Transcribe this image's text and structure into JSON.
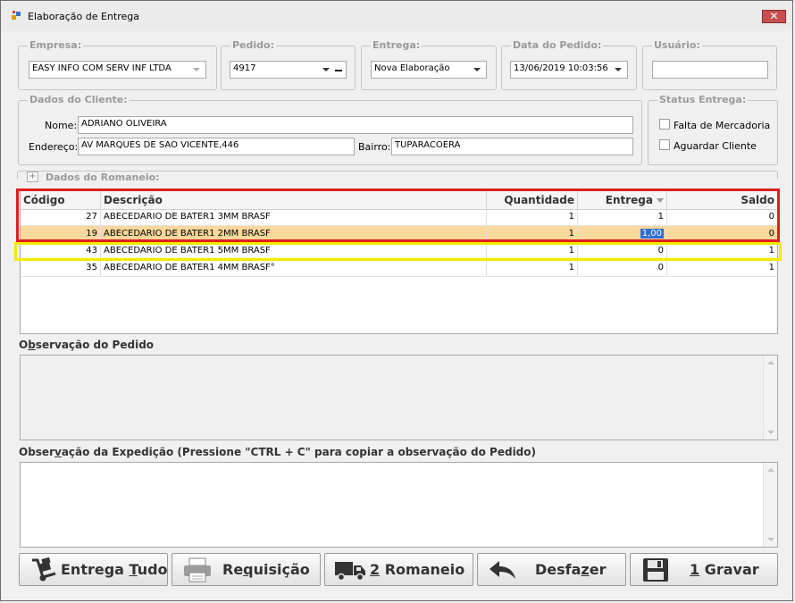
{
  "window": {
    "title": "Elaboração de Entrega",
    "close_label": "✕"
  },
  "top": {
    "empresa": {
      "label": "Empresa:",
      "value": "EASY INFO COM  SERV INF LTDA"
    },
    "pedido": {
      "label": "Pedido:",
      "value": "4917"
    },
    "entrega": {
      "label": "Entrega:",
      "value": "Nova Elaboração"
    },
    "data_pedido": {
      "label": "Data do Pedido:",
      "value": "13/06/2019 10:03:56"
    },
    "usuario": {
      "label": "Usuário:",
      "value": ""
    }
  },
  "cliente": {
    "group_label": "Dados do Cliente:",
    "nome_label": "Nome:",
    "nome_value": "ADRIANO OLIVEIRA",
    "endereco_label": "Endereço:",
    "endereco_value": "AV MARQUES DE SAO VICENTE,446",
    "bairro_label": "Bairro:",
    "bairro_value": "TUPARACOERA"
  },
  "status": {
    "group_label": "Status Entrega:",
    "falta_label": "Falta de Mercadoria",
    "aguardar_label": "Aguardar Cliente"
  },
  "romaneio": {
    "expander": "+",
    "label": "Dados do Romaneio:"
  },
  "grid": {
    "headers": {
      "codigo": "Código",
      "descricao": "Descrição",
      "quantidade": "Quantidade",
      "entrega": "Entrega",
      "saldo": "Saldo"
    },
    "rows": [
      {
        "codigo": "27",
        "descricao": "ABECEDARIO DE BATER1 3MM BRASF",
        "quantidade": "1",
        "entrega": "1",
        "saldo": "0"
      },
      {
        "codigo": "19",
        "descricao": "ABECEDARIO DE BATER1 2MM BRASF",
        "quantidade": "1",
        "entrega": "1,00",
        "saldo": "0"
      },
      {
        "codigo": "43",
        "descricao": "ABECEDARIO DE BATER1 5MM BRASF",
        "quantidade": "1",
        "entrega": "0",
        "saldo": "1"
      },
      {
        "codigo": "35",
        "descricao": "ABECEDARIO DE BATER1 4MM BRASF°",
        "quantidade": "1",
        "entrega": "0",
        "saldo": "1"
      }
    ]
  },
  "obs_pedido": {
    "label_pre": "O",
    "label_ul": "b",
    "label_post": "servação do Pedido"
  },
  "obs_expedicao": {
    "label_pre": "Obser",
    "label_ul": "v",
    "label_post": "ação da Expedição (Pressione \"CTRL + C\" para copiar a observação do Pedido)"
  },
  "buttons": {
    "entrega_tudo": {
      "pre": "Entrega ",
      "ul": "T",
      "post": "udo"
    },
    "requisicao": {
      "pre": "Re",
      "ul": "q",
      "post": "uisição"
    },
    "romaneio": {
      "pre": "",
      "ul": "2",
      "post": " Romaneio"
    },
    "desfazer": {
      "pre": "Desfa",
      "ul": "z",
      "post": "er"
    },
    "gravar": {
      "pre": "",
      "ul": "1",
      "post": " Gravar"
    }
  },
  "colors": {
    "selection_row": "#fbd89b",
    "red_frame": "#e01e1e",
    "yellow_frame": "#f3ea00",
    "cell_highlight": "#2f6fd6"
  }
}
